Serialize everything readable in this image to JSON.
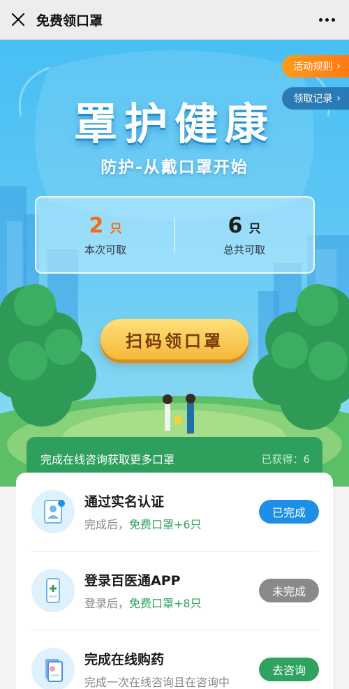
{
  "titlebar": {
    "title": "免费领口罩",
    "close_icon": "close-icon",
    "more_icon": "more-icon"
  },
  "hero": {
    "rules_label": "活动规则",
    "records_label": "领取记录",
    "headline": "罩护健康",
    "subtitle": "防护-从戴口罩开始",
    "this_time": {
      "num": "2",
      "unit": "只",
      "label": "本次可取"
    },
    "total": {
      "num": "6",
      "unit": "只",
      "label": "总共可取"
    },
    "scan_button": "扫码领口罩"
  },
  "tasks_section": {
    "title": "完成在线咨询获取更多口罩",
    "earned": "已获得：6",
    "items": [
      {
        "name": "通过实名认证",
        "desc_prefix": "完成后，",
        "desc_highlight": "免费口罩+6只",
        "button": "已完成",
        "status_color": "#1e8fe6"
      },
      {
        "name": "登录百医通APP",
        "desc_prefix": "登录后，",
        "desc_highlight": "免费口罩+8只",
        "button": "未完成",
        "status_color": "#8a8a8a"
      },
      {
        "name": "完成在线购药",
        "desc_prefix": "完成一次在线咨询且在咨询中",
        "desc_highlight": "",
        "button": "去咨询",
        "status_color": "#2ea35f"
      }
    ]
  },
  "colors": {
    "accent_orange": "#f36b12",
    "green": "#2f9f5e",
    "blue": "#1e8fe6"
  }
}
